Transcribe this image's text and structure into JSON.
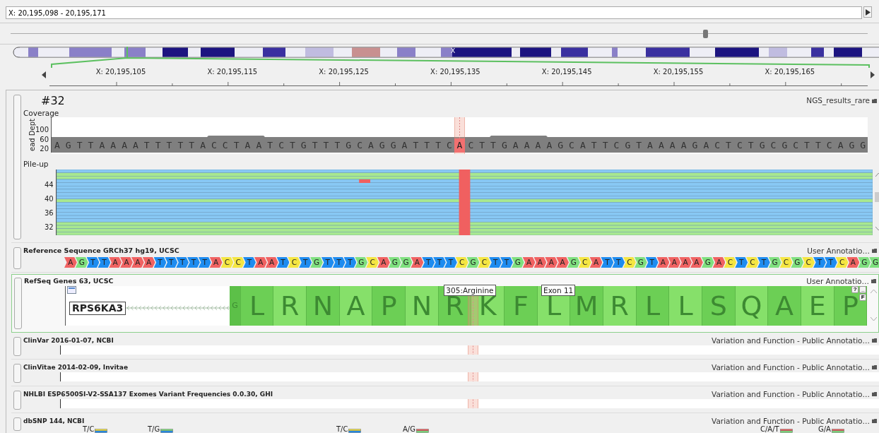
{
  "location": {
    "value": "X: 20,195,098 - 20,195,171"
  },
  "zoom_slider": {
    "level": 0.81
  },
  "chromosome": {
    "label": "X"
  },
  "ruler": {
    "labels": [
      "X: 20,195,105",
      "X: 20,195,115",
      "X: 20,195,125",
      "X: 20,195,135",
      "X: 20,195,145",
      "X: 20,195,155",
      "X: 20,195,165"
    ]
  },
  "sample_track": {
    "title": "#32",
    "source": "NGS_results_rare",
    "coverage": {
      "label": "Coverage",
      "axis_title": "ead Dept",
      "ticks": [
        "100",
        "60",
        "20"
      ],
      "before": "AGTTAAAATTTTTACCTAATCTGTTTGCAGGATTTC",
      "variant": "A",
      "after": "CTTGAAAAGCATTCGTAAAAGACTCTGCGCTTCAGG"
    },
    "pileup": {
      "label": "Pile-up",
      "ticks": [
        "44",
        "40",
        "36",
        "32"
      ]
    }
  },
  "reference": {
    "title": "Reference Sequence GRCh37 hg19, UCSC",
    "source": "User Annotatio…",
    "bases": [
      {
        "base": "A",
        "color": "#f06262"
      },
      {
        "base": "G",
        "color": "#7fe07f"
      },
      {
        "base": "T",
        "color": "#1e8cf0"
      },
      {
        "base": "T",
        "color": "#1e8cf0"
      },
      {
        "base": "A",
        "color": "#f06262"
      },
      {
        "base": "A",
        "color": "#f06262"
      },
      {
        "base": "A",
        "color": "#f06262"
      },
      {
        "base": "A",
        "color": "#f06262"
      },
      {
        "base": "T",
        "color": "#1e8cf0"
      },
      {
        "base": "T",
        "color": "#1e8cf0"
      },
      {
        "base": "T",
        "color": "#1e8cf0"
      },
      {
        "base": "T",
        "color": "#1e8cf0"
      },
      {
        "base": "T",
        "color": "#1e8cf0"
      },
      {
        "base": "A",
        "color": "#f06262"
      },
      {
        "base": "C",
        "color": "#f5e642"
      },
      {
        "base": "C",
        "color": "#f5e642"
      },
      {
        "base": "T",
        "color": "#1e8cf0"
      },
      {
        "base": "A",
        "color": "#f06262"
      },
      {
        "base": "A",
        "color": "#f06262"
      },
      {
        "base": "T",
        "color": "#1e8cf0"
      },
      {
        "base": "C",
        "color": "#f5e642"
      },
      {
        "base": "T",
        "color": "#1e8cf0"
      },
      {
        "base": "G",
        "color": "#7fe07f"
      },
      {
        "base": "T",
        "color": "#1e8cf0"
      },
      {
        "base": "T",
        "color": "#1e8cf0"
      },
      {
        "base": "T",
        "color": "#1e8cf0"
      },
      {
        "base": "G",
        "color": "#7fe07f"
      },
      {
        "base": "C",
        "color": "#f5e642"
      },
      {
        "base": "A",
        "color": "#f06262"
      },
      {
        "base": "G",
        "color": "#7fe07f"
      },
      {
        "base": "G",
        "color": "#7fe07f"
      },
      {
        "base": "A",
        "color": "#f06262"
      },
      {
        "base": "T",
        "color": "#1e8cf0"
      },
      {
        "base": "T",
        "color": "#1e8cf0"
      },
      {
        "base": "T",
        "color": "#1e8cf0"
      },
      {
        "base": "C",
        "color": "#f5e642"
      },
      {
        "base": "G",
        "color": "#7fe07f"
      },
      {
        "base": "C",
        "color": "#f5e642"
      },
      {
        "base": "T",
        "color": "#1e8cf0"
      },
      {
        "base": "T",
        "color": "#1e8cf0"
      },
      {
        "base": "G",
        "color": "#7fe07f"
      },
      {
        "base": "A",
        "color": "#f06262"
      },
      {
        "base": "A",
        "color": "#f06262"
      },
      {
        "base": "A",
        "color": "#f06262"
      },
      {
        "base": "A",
        "color": "#f06262"
      },
      {
        "base": "G",
        "color": "#7fe07f"
      },
      {
        "base": "C",
        "color": "#f5e642"
      },
      {
        "base": "A",
        "color": "#f06262"
      },
      {
        "base": "T",
        "color": "#1e8cf0"
      },
      {
        "base": "T",
        "color": "#1e8cf0"
      },
      {
        "base": "C",
        "color": "#f5e642"
      },
      {
        "base": "G",
        "color": "#7fe07f"
      },
      {
        "base": "T",
        "color": "#1e8cf0"
      },
      {
        "base": "A",
        "color": "#f06262"
      },
      {
        "base": "A",
        "color": "#f06262"
      },
      {
        "base": "A",
        "color": "#f06262"
      },
      {
        "base": "A",
        "color": "#f06262"
      },
      {
        "base": "G",
        "color": "#7fe07f"
      },
      {
        "base": "A",
        "color": "#f06262"
      },
      {
        "base": "C",
        "color": "#f5e642"
      },
      {
        "base": "T",
        "color": "#1e8cf0"
      },
      {
        "base": "C",
        "color": "#f5e642"
      },
      {
        "base": "T",
        "color": "#1e8cf0"
      },
      {
        "base": "G",
        "color": "#7fe07f"
      },
      {
        "base": "C",
        "color": "#f5e642"
      },
      {
        "base": "G",
        "color": "#7fe07f"
      },
      {
        "base": "C",
        "color": "#f5e642"
      },
      {
        "base": "T",
        "color": "#1e8cf0"
      },
      {
        "base": "T",
        "color": "#1e8cf0"
      },
      {
        "base": "C",
        "color": "#f5e642"
      },
      {
        "base": "A",
        "color": "#f06262"
      },
      {
        "base": "G",
        "color": "#7fe07f"
      },
      {
        "base": "G",
        "color": "#7fe07f"
      }
    ]
  },
  "genes": {
    "title": "RefSeq Genes 63, UCSC",
    "source": "User Annotatio…",
    "gene": "RPS6KA3",
    "partial_codon": "G",
    "amino_acids": [
      "L",
      "R",
      "N",
      "A",
      "P",
      "N",
      "R",
      "K",
      "F",
      "L",
      "M",
      "R",
      "L",
      "L",
      "S",
      "Q",
      "A",
      "E",
      "P"
    ],
    "tooltips": [
      "305:Arginine",
      "Exon 11"
    ],
    "window_buttons": [
      "?",
      "_",
      "F"
    ]
  },
  "annotation_tracks": [
    {
      "title": "ClinVar 2016-01-07, NCBI",
      "source": "Variation and Function - Public Annotatio…"
    },
    {
      "title": "ClinVitae 2014-02-09, Invitae",
      "source": "Variation and Function - Public Annotatio…"
    },
    {
      "title": "NHLBI ESP6500SI-V2-SSA137 Exomes Variant Frequencies 0.0.30, GHI",
      "source": "Variation and Function - Public Annotatio…"
    },
    {
      "title": "dbSNP 144, NCBI",
      "source": "Variation and Function - Public Annotatio…",
      "variants": [
        "T/C",
        "T/G",
        "T/C",
        "A/G",
        "C/A/T",
        "G/A"
      ]
    }
  ]
}
